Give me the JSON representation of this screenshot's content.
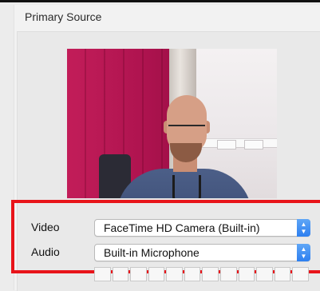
{
  "section": {
    "title": "Primary Source"
  },
  "preview": {
    "description_icon": "camera-preview"
  },
  "video": {
    "label": "Video",
    "selected": "FaceTime HD Camera (Built-in)"
  },
  "audio": {
    "label": "Audio",
    "selected": "Built-in Microphone"
  },
  "meter": {
    "segments": 12,
    "level": 0
  },
  "colors": {
    "highlight": "#e8141a",
    "accent": "#2d7ff0"
  }
}
